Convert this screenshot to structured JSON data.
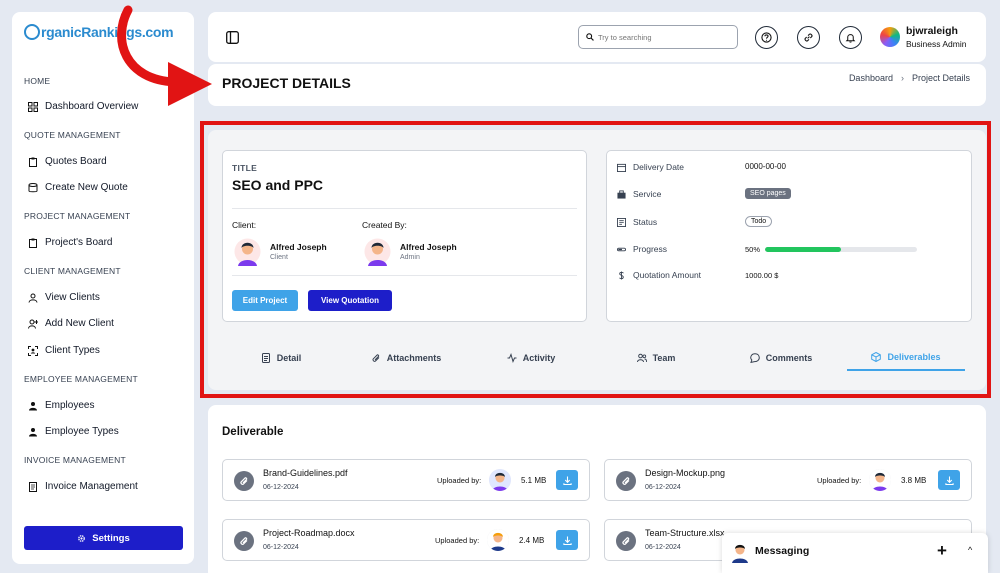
{
  "brand": {
    "logo_text": "rganicRankings.com"
  },
  "sidebar": {
    "sections": [
      {
        "label": "HOME"
      },
      {
        "label": "QUOTE MANAGEMENT"
      },
      {
        "label": "PROJECT MANAGEMENT"
      },
      {
        "label": "CLIENT MANAGEMENT"
      },
      {
        "label": "EMPLOYEE MANAGEMENT"
      },
      {
        "label": "INVOICE MANAGEMENT"
      }
    ],
    "items": [
      {
        "label": "Dashboard Overview",
        "icon": "grid-icon"
      },
      {
        "label": "Quotes Board",
        "icon": "clipboard-icon"
      },
      {
        "label": "Create New Quote",
        "icon": "database-icon"
      },
      {
        "label": "Project's Board",
        "icon": "clipboard-icon"
      },
      {
        "label": "View Clients",
        "icon": "user-icon"
      },
      {
        "label": "Add New Client",
        "icon": "user-plus-icon"
      },
      {
        "label": "Client Types",
        "icon": "user-scan-icon"
      },
      {
        "label": "Employees",
        "icon": "users-icon"
      },
      {
        "label": "Employee Types",
        "icon": "users-icon"
      },
      {
        "label": "Invoice Management",
        "icon": "file-icon"
      }
    ],
    "settings_label": "Settings"
  },
  "header": {
    "search_placeholder": "Try to searching",
    "user_name": "bjwraleigh",
    "user_role": "Business Admin"
  },
  "page": {
    "title": "PROJECT DETAILS",
    "breadcrumb": [
      "Dashboard",
      "Project Details"
    ]
  },
  "project": {
    "title_label": "TITLE",
    "name": "SEO and PPC",
    "client_label": "Client:",
    "created_by_label": "Created By:",
    "client": {
      "name": "Alfred Joseph",
      "role": "Client"
    },
    "creator": {
      "name": "Alfred Joseph",
      "role": "Admin"
    },
    "edit_label": "Edit Project",
    "view_label": "View Quotation",
    "details": {
      "delivery_label": "Delivery Date",
      "delivery_value": "0000-00-00",
      "service_label": "Service",
      "service_value": "SEO pages",
      "status_label": "Status",
      "status_value": "Todo",
      "progress_label": "Progress",
      "progress_value": "50%",
      "progress_fraction": 0.5,
      "amount_label": "Quotation Amount",
      "amount_value": "1000.00 $"
    },
    "tabs": [
      {
        "label": "Detail",
        "icon": "document-icon"
      },
      {
        "label": "Attachments",
        "icon": "paperclip-icon"
      },
      {
        "label": "Activity",
        "icon": "activity-icon"
      },
      {
        "label": "Team",
        "icon": "team-icon"
      },
      {
        "label": "Comments",
        "icon": "comment-icon"
      },
      {
        "label": "Deliverables",
        "icon": "cube-icon"
      }
    ]
  },
  "deliverables": {
    "title": "Deliverable",
    "uploaded_label": "Uploaded by:",
    "files": [
      {
        "name": "Brand-Guidelines.pdf",
        "date": "06-12-2024",
        "size": "5.1 MB"
      },
      {
        "name": "Design-Mockup.png",
        "date": "06-12-2024",
        "size": "3.8 MB"
      },
      {
        "name": "Project-Roadmap.docx",
        "date": "06-12-2024",
        "size": "2.4 MB"
      },
      {
        "name": "Team-Structure.xlsx",
        "date": "06-12-2024",
        "size": ""
      }
    ]
  },
  "messaging": {
    "title": "Messaging",
    "plus": "+",
    "chevron": "^"
  },
  "colors": {
    "primary": "#1d1ec9",
    "accent": "#3fa3e8",
    "progress": "#22c55e",
    "annotation": "#e11414"
  }
}
